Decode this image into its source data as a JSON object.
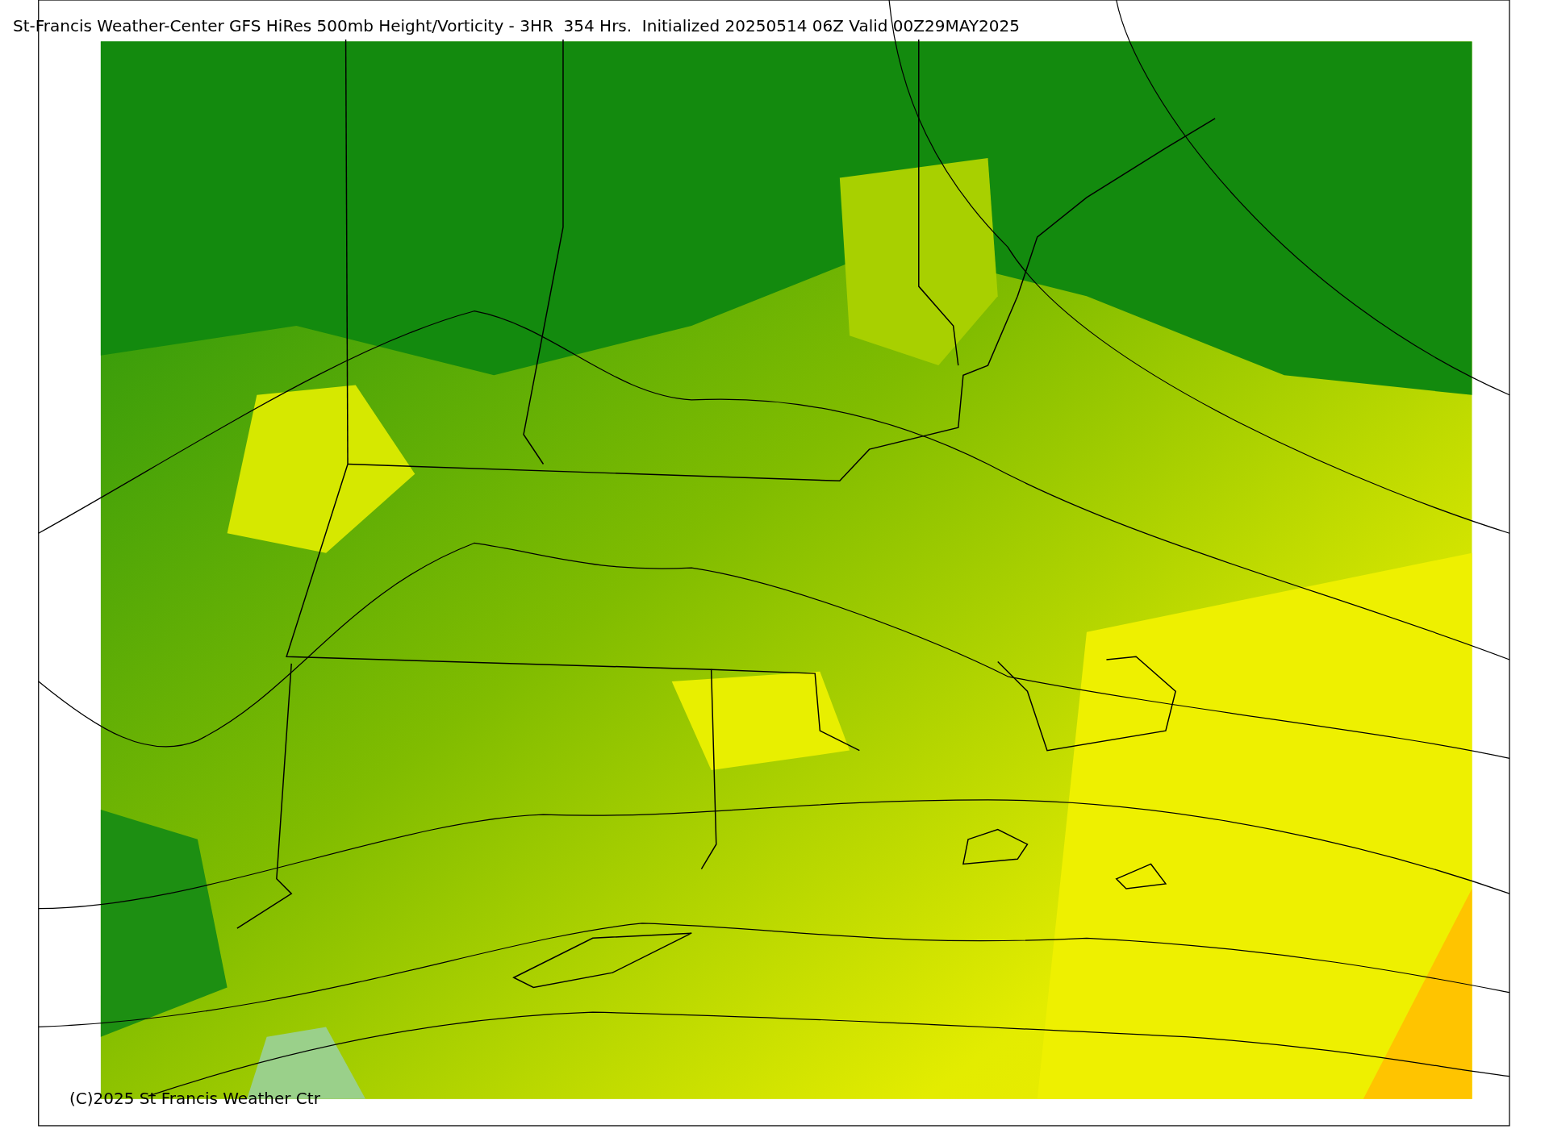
{
  "title": "St-Francis Weather-Center GFS HiRes 500mb Height/Vorticity - 3HR  354 Hrs.  Initialized 20250514 06Z Valid 00Z29MAY2025",
  "copyright": "(C)2025 St Francis Weather Ctr"
}
